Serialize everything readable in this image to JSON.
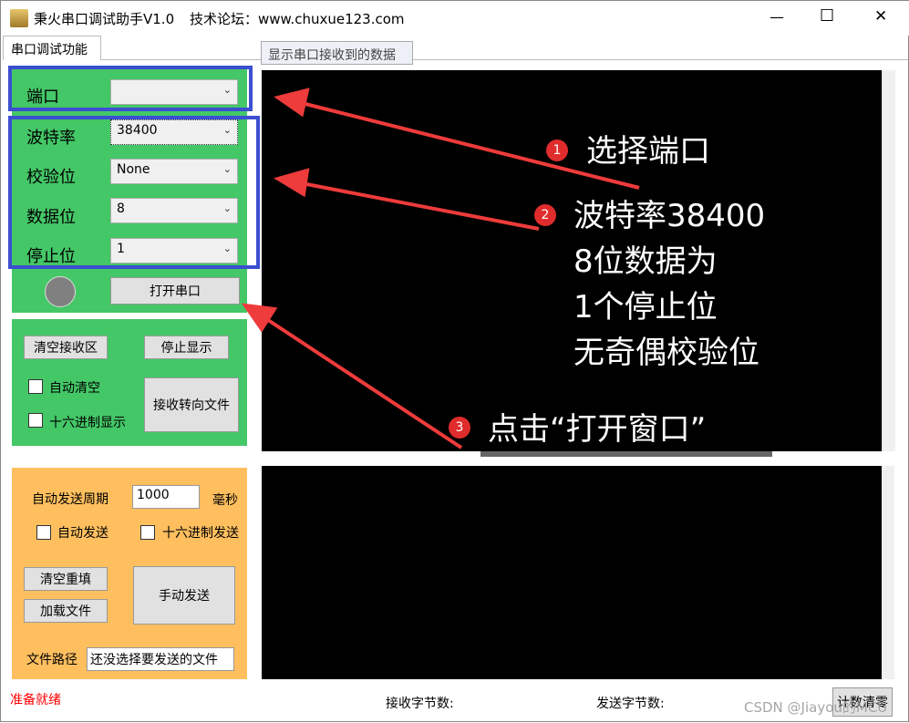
{
  "window": {
    "title": "秉火串口调试助手V1.0",
    "forum": "技术论坛：www.chuxue123.com",
    "minimize": "—",
    "maximize": "☐",
    "close": "✕"
  },
  "tabs": {
    "main": "串口调试功能",
    "receive": "显示串口接收到的数据"
  },
  "serial": {
    "port_label": "端口",
    "port_value": "",
    "baud_label": "波特率",
    "baud_value": "38400",
    "parity_label": "校验位",
    "parity_value": "None",
    "databits_label": "数据位",
    "databits_value": "8",
    "stopbits_label": "停止位",
    "stopbits_value": "1",
    "open_button": "打开串口"
  },
  "receive": {
    "clear_button": "清空接收区",
    "stop_button": "停止显示",
    "auto_clear": "自动清空",
    "hex_display": "十六进制显示",
    "to_file_button": "接收转向文件"
  },
  "send": {
    "period_label": "自动发送周期",
    "period_value": "1000",
    "period_unit": "毫秒",
    "auto_send": "自动发送",
    "hex_send": "十六进制发送",
    "clear_button": "清空重填",
    "load_button": "加载文件",
    "manual_button": "手动发送",
    "path_label": "文件路径",
    "path_value": "还没选择要发送的文件"
  },
  "status": {
    "ready": "准备就绪",
    "rx_bytes": "接收字节数:",
    "tx_bytes": "发送字节数:",
    "reset_button": "计数清零",
    "watermark": "CSDN @Jiayou的MCU"
  },
  "annotations": [
    {
      "num": "1",
      "text": "选择端口"
    },
    {
      "num": "2",
      "lines": [
        "波特率38400",
        "8位数据为",
        "1个停止位",
        "无奇偶校验位"
      ]
    },
    {
      "num": "3",
      "text": "点击“打开窗口”"
    }
  ],
  "colors": {
    "green": "#44c767",
    "orange": "#ffbf5f",
    "blue": "#3b4fd0",
    "red": "#ee3b3b"
  }
}
